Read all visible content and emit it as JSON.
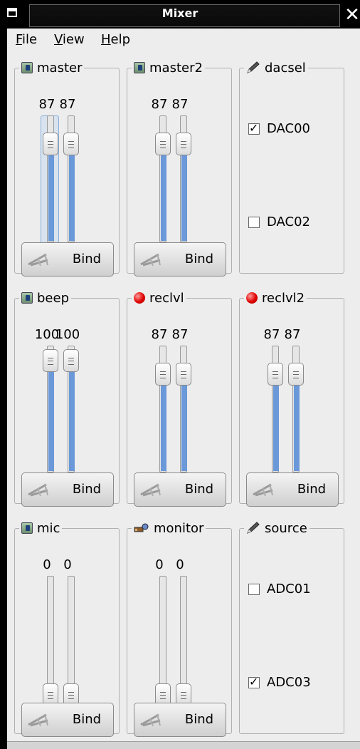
{
  "window": {
    "title": "Mixer",
    "close_glyph": "✕"
  },
  "menubar": [
    {
      "label": "File",
      "mnemonic": "F",
      "rest": "ile"
    },
    {
      "label": "View",
      "mnemonic": "V",
      "rest": "iew"
    },
    {
      "label": "Help",
      "mnemonic": "H",
      "rest": "elp"
    }
  ],
  "colors": {
    "slider_fill": "#6a98d8",
    "background": "#ededed",
    "titlebar": "#000000"
  },
  "channels": {
    "master": {
      "name": "master",
      "icon": "volume-icon",
      "left": "87",
      "right": "87",
      "left_level": 0.87,
      "right_level": 0.87,
      "bind": "Bind",
      "focused": true
    },
    "master2": {
      "name": "master2",
      "icon": "volume-icon",
      "left": "87",
      "right": "87",
      "left_level": 0.87,
      "right_level": 0.87,
      "bind": "Bind"
    },
    "beep": {
      "name": "beep",
      "icon": "volume-icon",
      "left": "100",
      "right": "100",
      "left_level": 1.0,
      "right_level": 1.0,
      "bind": "Bind"
    },
    "reclvl": {
      "name": "reclvl",
      "icon": "record-icon",
      "left": "87",
      "right": "87",
      "left_level": 0.87,
      "right_level": 0.87,
      "bind": "Bind"
    },
    "reclvl2": {
      "name": "reclvl2",
      "icon": "record-icon",
      "left": "87",
      "right": "87",
      "left_level": 0.87,
      "right_level": 0.87,
      "bind": "Bind"
    },
    "mic": {
      "name": "mic",
      "icon": "volume-icon",
      "left": "0",
      "right": "0",
      "left_level": 0.0,
      "right_level": 0.0,
      "bind": "Bind"
    },
    "monitor": {
      "name": "monitor",
      "icon": "monitor-icon",
      "left": "0",
      "right": "0",
      "left_level": 0.0,
      "right_level": 0.0,
      "bind": "Bind"
    }
  },
  "selectors": {
    "dacsel": {
      "name": "dacsel",
      "icon": "pen-icon",
      "options": [
        {
          "label": "DAC00",
          "checked": true
        },
        {
          "label": "DAC02",
          "checked": false
        }
      ]
    },
    "source": {
      "name": "source",
      "icon": "pen-icon",
      "options": [
        {
          "label": "ADC01",
          "checked": false
        },
        {
          "label": "ADC03",
          "checked": true
        }
      ]
    }
  }
}
